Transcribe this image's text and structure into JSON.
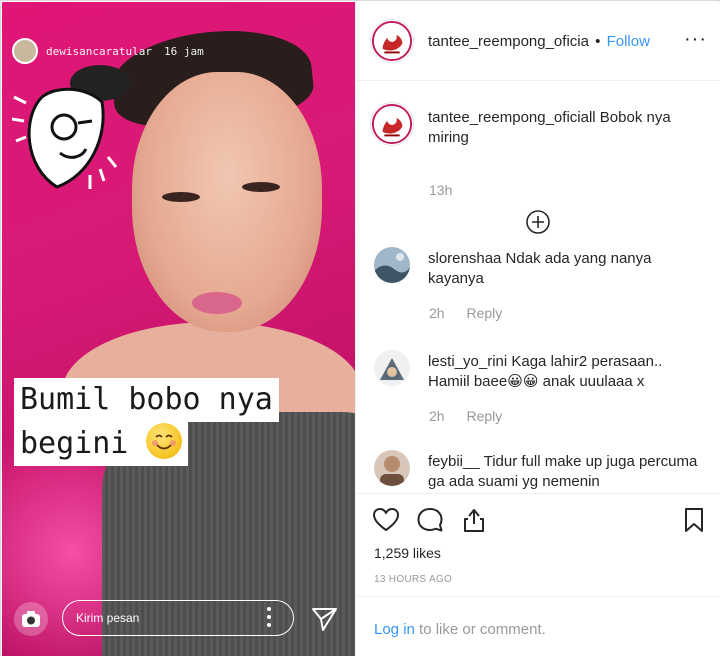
{
  "story": {
    "username": "dewisancaratular",
    "time": "16 jam",
    "caption_line1": "Bumil bobo nya",
    "caption_line2": "begini",
    "message_placeholder": "Kirim pesan",
    "icons": [
      "camera-icon",
      "more-vertical-icon",
      "send-icon",
      "smile-emoji-icon",
      "cartoon-sticker"
    ]
  },
  "post": {
    "header": {
      "username": "tantee_reempong_oficia",
      "separator": "•",
      "follow_label": "Follow",
      "more_label": "···"
    },
    "caption": {
      "text": "tantee_reempong_oficiall Bobok nya miring",
      "time": "13h"
    },
    "comments": [
      {
        "text": "slorenshaa Ndak ada yang nanya kayanya",
        "time": "2h",
        "reply_label": "Reply"
      },
      {
        "text": "lesti_yo_rini Kaga lahir2 perasaan.. Hamiil baee😀😀 anak uuulaaa x",
        "time": "2h",
        "reply_label": "Reply"
      },
      {
        "text": "feybii__ Tidur full make up juga percuma ga ada suami yg nemenin",
        "time": "",
        "reply_label": ""
      }
    ],
    "likes": "1,259 likes",
    "posted_ago": "13 HOURS AGO",
    "login_link": "Log in",
    "login_suffix": " to like or comment."
  },
  "colors": {
    "accent": "#3897f0",
    "story_bg": "#d81a77",
    "muted_text": "#999999"
  }
}
